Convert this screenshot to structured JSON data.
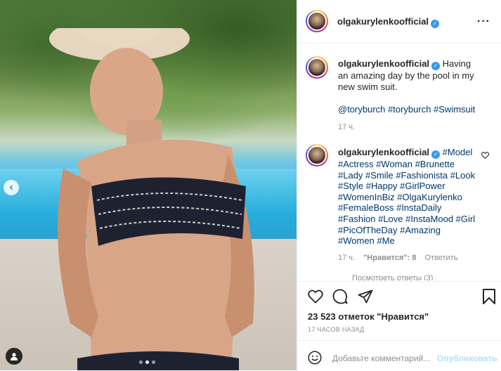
{
  "post": {
    "username": "olgakurylenkoofficial",
    "more_icon": "ellipsis-icon"
  },
  "caption": {
    "username": "olgakurylenkoofficial",
    "text": "Having an amazing day by the pool in my new swim suit.",
    "mentions": "@toryburch #toryburch #Swimsuit",
    "time": "17 ч."
  },
  "comment": {
    "username": "olgakurylenkoofficial",
    "hashtags_line1": "#Model",
    "hashtags_rest": "#Actress #Woman #Brunette #Lady #Smile #Fashionista #Look #Style #Happy #GirlPower #WomenInBiz #OlgaKurylenko #FemaleBoss #InstaDaily #Fashion #Love #InstaMood #Girl #PicOfTheDay #Amazing #Women #Me",
    "time": "17 ч.",
    "likes": "\"Нравится\": 8",
    "reply": "Ответить",
    "view_replies": "Посмотреть ответы (3)"
  },
  "actions": {
    "likes_text": "23 523 отметок \"Нравится\"",
    "time_ago": "17 ЧАСОВ НАЗАД",
    "comment_placeholder": "Добавьте комментарий...",
    "publish_label": "Опубликовать"
  },
  "colors": {
    "link": "#00376b",
    "verified": "#3897f0",
    "publish_disabled": "#b2dffc"
  }
}
